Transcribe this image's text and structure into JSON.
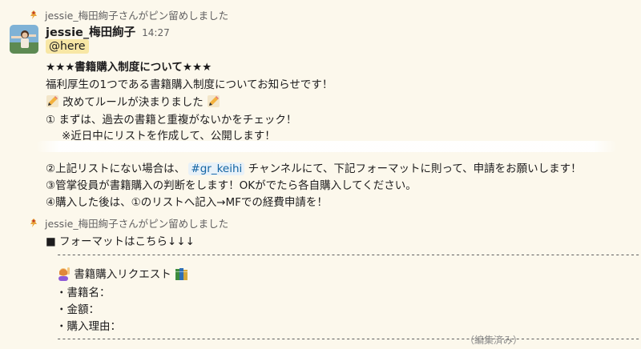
{
  "pin1": {
    "text": "jessie_梅田絢子さんがピン留めしました"
  },
  "message": {
    "sender": "jessie_梅田絢子",
    "time": "14:27",
    "mention": "@here",
    "lines": {
      "title": "★★★書籍購入制度について★★★",
      "intro": "福利厚生の1つである書籍購入制度についてお知らせです！",
      "rules": "改めてルールが決まりました",
      "step1": "① まずは、過去の書籍と重複がないかをチェック！",
      "step1_note": "※近日中にリストを作成して、公開します！",
      "step2_pre": "②上記リストにない場合は、",
      "step2_channel": "#gr_keihi",
      "step2_post": "チャンネルにて、下記フォーマットに則って、申請をお願いします！",
      "step3": "③管掌役員が書籍購入の判断をします！OKがでたら各自購入してください。",
      "step4": "④購入した後は、①のリストへ記入→MFでの経費申請を！"
    }
  },
  "pin2": {
    "text": "jessie_梅田絢子さんがピン留めしました"
  },
  "message2": {
    "format_heading": "■ フォーマットはこちら↓↓↓",
    "dash_line": "------------------------------------------------------------------------------------------------------------------------",
    "request_title": "書籍購入リクエスト",
    "field_name": "・書籍名：",
    "field_price": "・金額：",
    "field_reason": "・購入理由：",
    "edited": "（編集済み）"
  },
  "colors": {
    "background": "#fcf8ec",
    "mention_bg": "#f8e7a5",
    "channel_link": "#1264a3"
  },
  "icons": [
    "pin-icon",
    "pencil-emoji",
    "person-raising-hand-emoji",
    "books-emoji"
  ]
}
